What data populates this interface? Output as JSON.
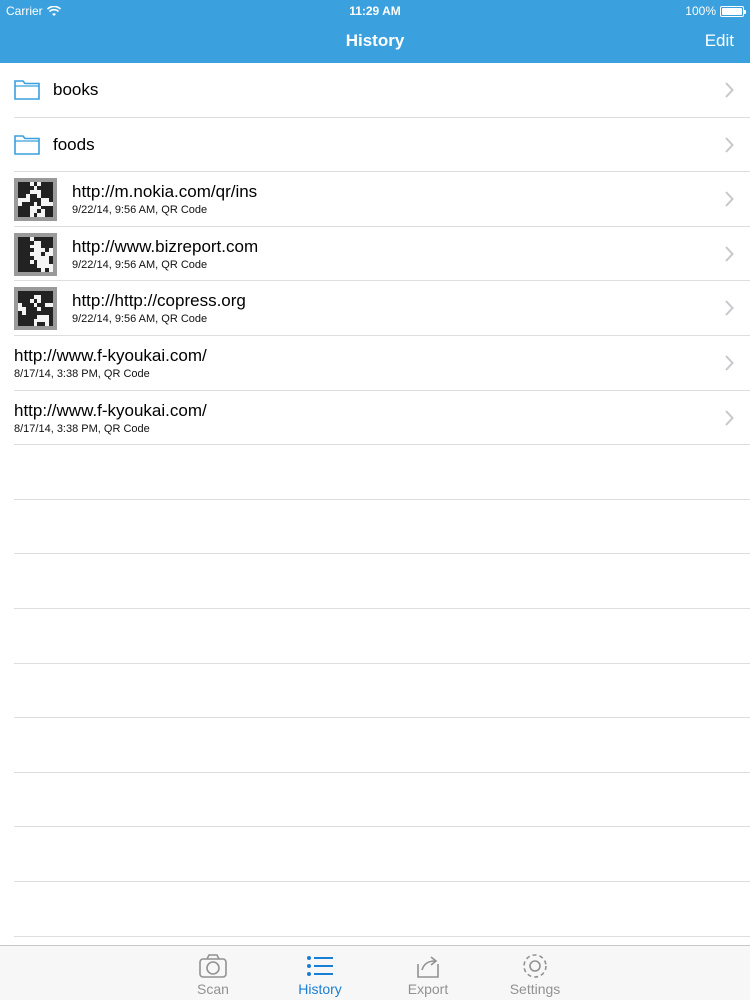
{
  "status_bar": {
    "carrier": "Carrier",
    "time": "11:29 AM",
    "battery": "100%",
    "battery_level": 1.0
  },
  "nav": {
    "title": "History",
    "edit_label": "Edit"
  },
  "folders": [
    {
      "name": "books"
    },
    {
      "name": "foods"
    }
  ],
  "entries": [
    {
      "title": "http://m.nokia.com/qr/ins",
      "subtitle": "9/22/14, 9:56 AM,  QR Code",
      "has_thumbnail": true
    },
    {
      "title": "http://www.bizreport.com",
      "subtitle": "9/22/14, 9:56 AM,  QR Code",
      "has_thumbnail": true
    },
    {
      "title": "http://http://copress.org",
      "subtitle": "9/22/14, 9:56 AM,  QR Code",
      "has_thumbnail": true
    },
    {
      "title": "http://www.f-kyoukai.com/",
      "subtitle": "8/17/14, 3:38 PM,  QR Code",
      "has_thumbnail": false
    },
    {
      "title": "http://www.f-kyoukai.com/",
      "subtitle": "8/17/14, 3:38 PM,  QR Code",
      "has_thumbnail": false
    }
  ],
  "tabs": [
    {
      "label": "Scan",
      "icon": "camera-icon",
      "active": false
    },
    {
      "label": "History",
      "icon": "list-icon",
      "active": true
    },
    {
      "label": "Export",
      "icon": "share-icon",
      "active": false
    },
    {
      "label": "Settings",
      "icon": "gear-icon",
      "active": false
    }
  ],
  "colors": {
    "nav_bar": "#3aa0de",
    "accent": "#1a7fd4",
    "inactive_tab": "#929292",
    "folder": "#3aa0de"
  }
}
